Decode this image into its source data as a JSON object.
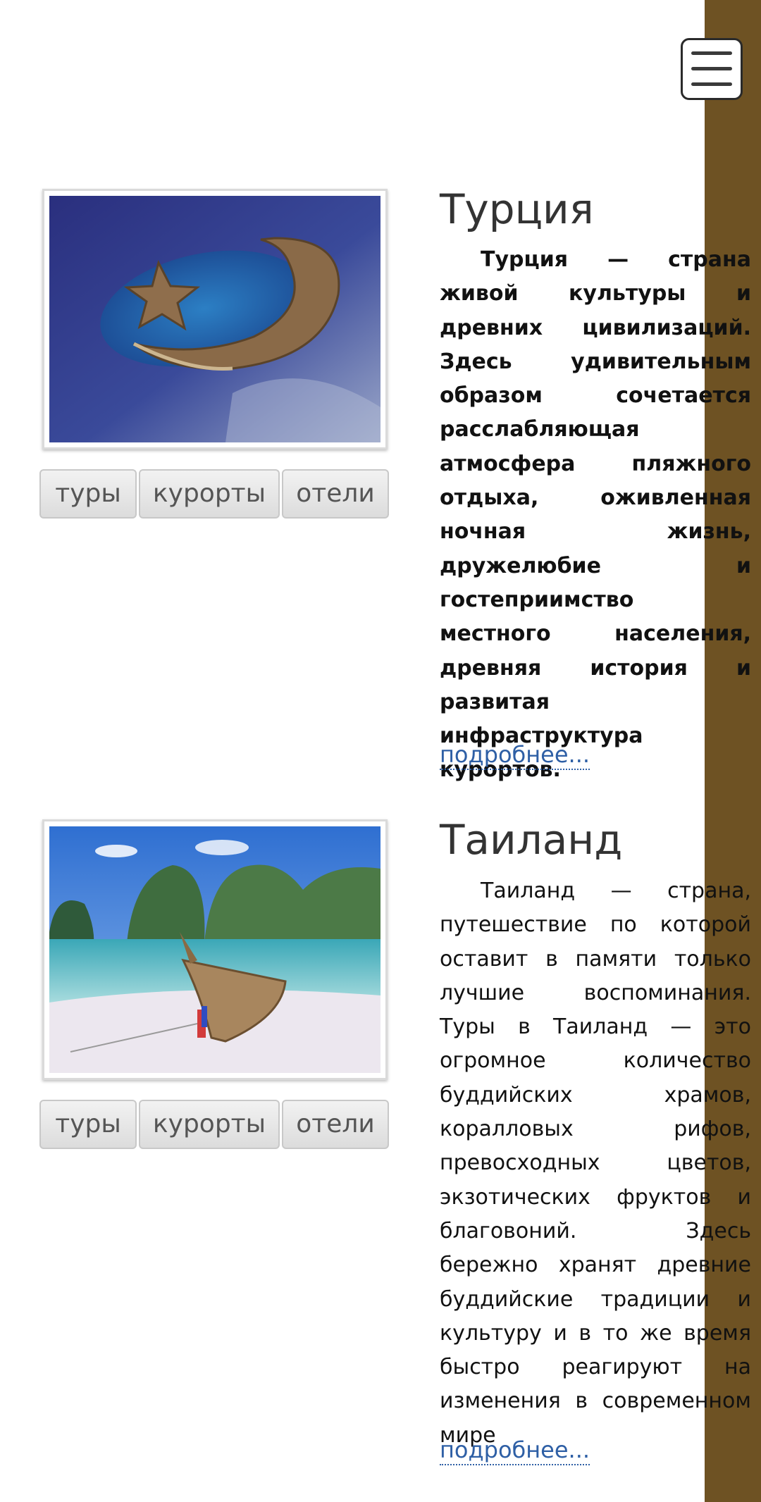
{
  "header": {
    "menu_icon": "hamburger-menu-icon"
  },
  "colors": {
    "sidebar": "#6e5223",
    "link": "#2e5fa5",
    "title": "#333333"
  },
  "countries": [
    {
      "title": "Турция",
      "image_alt": "island-crescent-star-photo",
      "buttons": [
        "туры",
        "курорты",
        "отели"
      ],
      "description": "Турция — страна живой культуры и древних цивилизаций. Здесь удивительным образом сочетается расслабляющая атмосфера пляжного отдыха, оживленная ночная жизнь, дружелюбие и гостеприимство местного населения, древняя история и развитая инфраструктура курортов.",
      "more_link": "подробнее..."
    },
    {
      "title": "Таиланд",
      "image_alt": "tropical-beach-longtail-boat-photo",
      "buttons": [
        "туры",
        "курорты",
        "отели"
      ],
      "description": "Таиланд — страна, путешествие по которой оставит в памяти только лучшие воспоминания. Туры в Таиланд — это огромное количество буддийских храмов, коралловых рифов, превосходных цветов, экзотических фруктов и благовоний. Здесь бережно хранят древние буддийские традиции и культуру и в то же время быстро реагируют на изменения в современном мире",
      "more_link": "подробнее..."
    }
  ]
}
